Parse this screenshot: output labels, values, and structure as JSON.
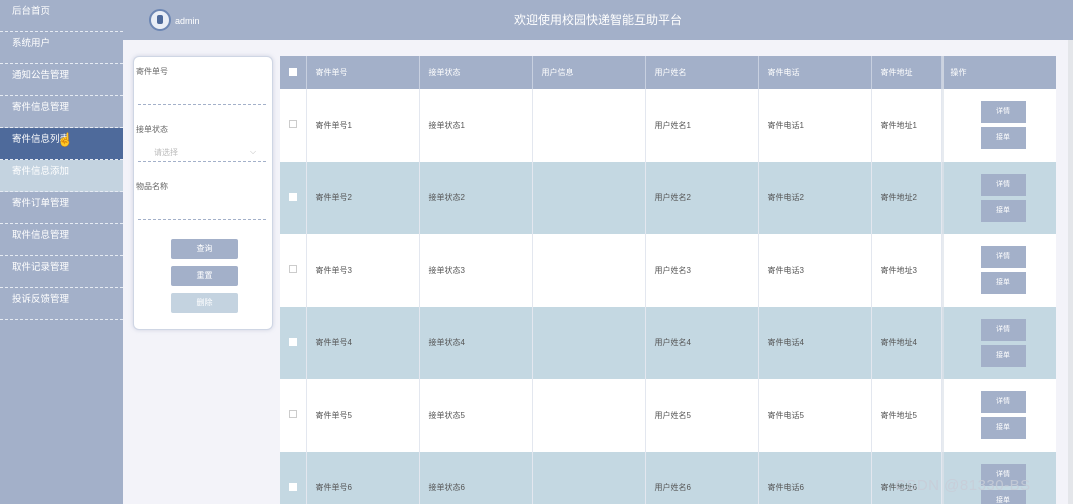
{
  "sidebar": {
    "items": [
      {
        "label": "后台首页",
        "state": "normal"
      },
      {
        "label": "系统用户",
        "state": "normal"
      },
      {
        "label": "通知公告管理",
        "state": "normal"
      },
      {
        "label": "寄件信息管理",
        "state": "normal"
      },
      {
        "label": "寄件信息列表",
        "state": "active"
      },
      {
        "label": "寄件信息添加",
        "state": "sub"
      },
      {
        "label": "寄件订单管理",
        "state": "normal"
      },
      {
        "label": "取件信息管理",
        "state": "normal"
      },
      {
        "label": "取件记录管理",
        "state": "normal"
      },
      {
        "label": "投诉反馈管理",
        "state": "normal"
      }
    ]
  },
  "header": {
    "admin": "admin",
    "title": "欢迎使用校园快递智能互助平台"
  },
  "search": {
    "f1_label": "寄件单号",
    "f2_label": "接单状态",
    "f2_placeholder": "请选择",
    "f3_label": "物品名称",
    "query": "查询",
    "reset": "重置",
    "delete": "删除"
  },
  "table": {
    "columns": [
      "寄件单号",
      "接单状态",
      "用户信息",
      "用户姓名",
      "寄件电话",
      "寄件地址",
      "操作"
    ],
    "rows": [
      {
        "no": "寄件单号1",
        "status": "接单状态1",
        "info": "",
        "name": "用户姓名1",
        "phone": "寄件电话1",
        "addr": "寄件地址1"
      },
      {
        "no": "寄件单号2",
        "status": "接单状态2",
        "info": "",
        "name": "用户姓名2",
        "phone": "寄件电话2",
        "addr": "寄件地址2"
      },
      {
        "no": "寄件单号3",
        "status": "接单状态3",
        "info": "",
        "name": "用户姓名3",
        "phone": "寄件电话3",
        "addr": "寄件地址3"
      },
      {
        "no": "寄件单号4",
        "status": "接单状态4",
        "info": "",
        "name": "用户姓名4",
        "phone": "寄件电话4",
        "addr": "寄件地址4"
      },
      {
        "no": "寄件单号5",
        "status": "接单状态5",
        "info": "",
        "name": "用户姓名5",
        "phone": "寄件电话5",
        "addr": "寄件地址5"
      },
      {
        "no": "寄件单号6",
        "status": "接单状态6",
        "info": "",
        "name": "用户姓名6",
        "phone": "寄件电话6",
        "addr": "寄件地址6"
      }
    ],
    "detail_label": "详情",
    "accept_label": "接单"
  },
  "watermark": "CSDN @81330-BS",
  "icons": {
    "avatar": "avatar-icon",
    "cursor": "hand-cursor-icon",
    "chevron": "chevron-down-icon"
  }
}
